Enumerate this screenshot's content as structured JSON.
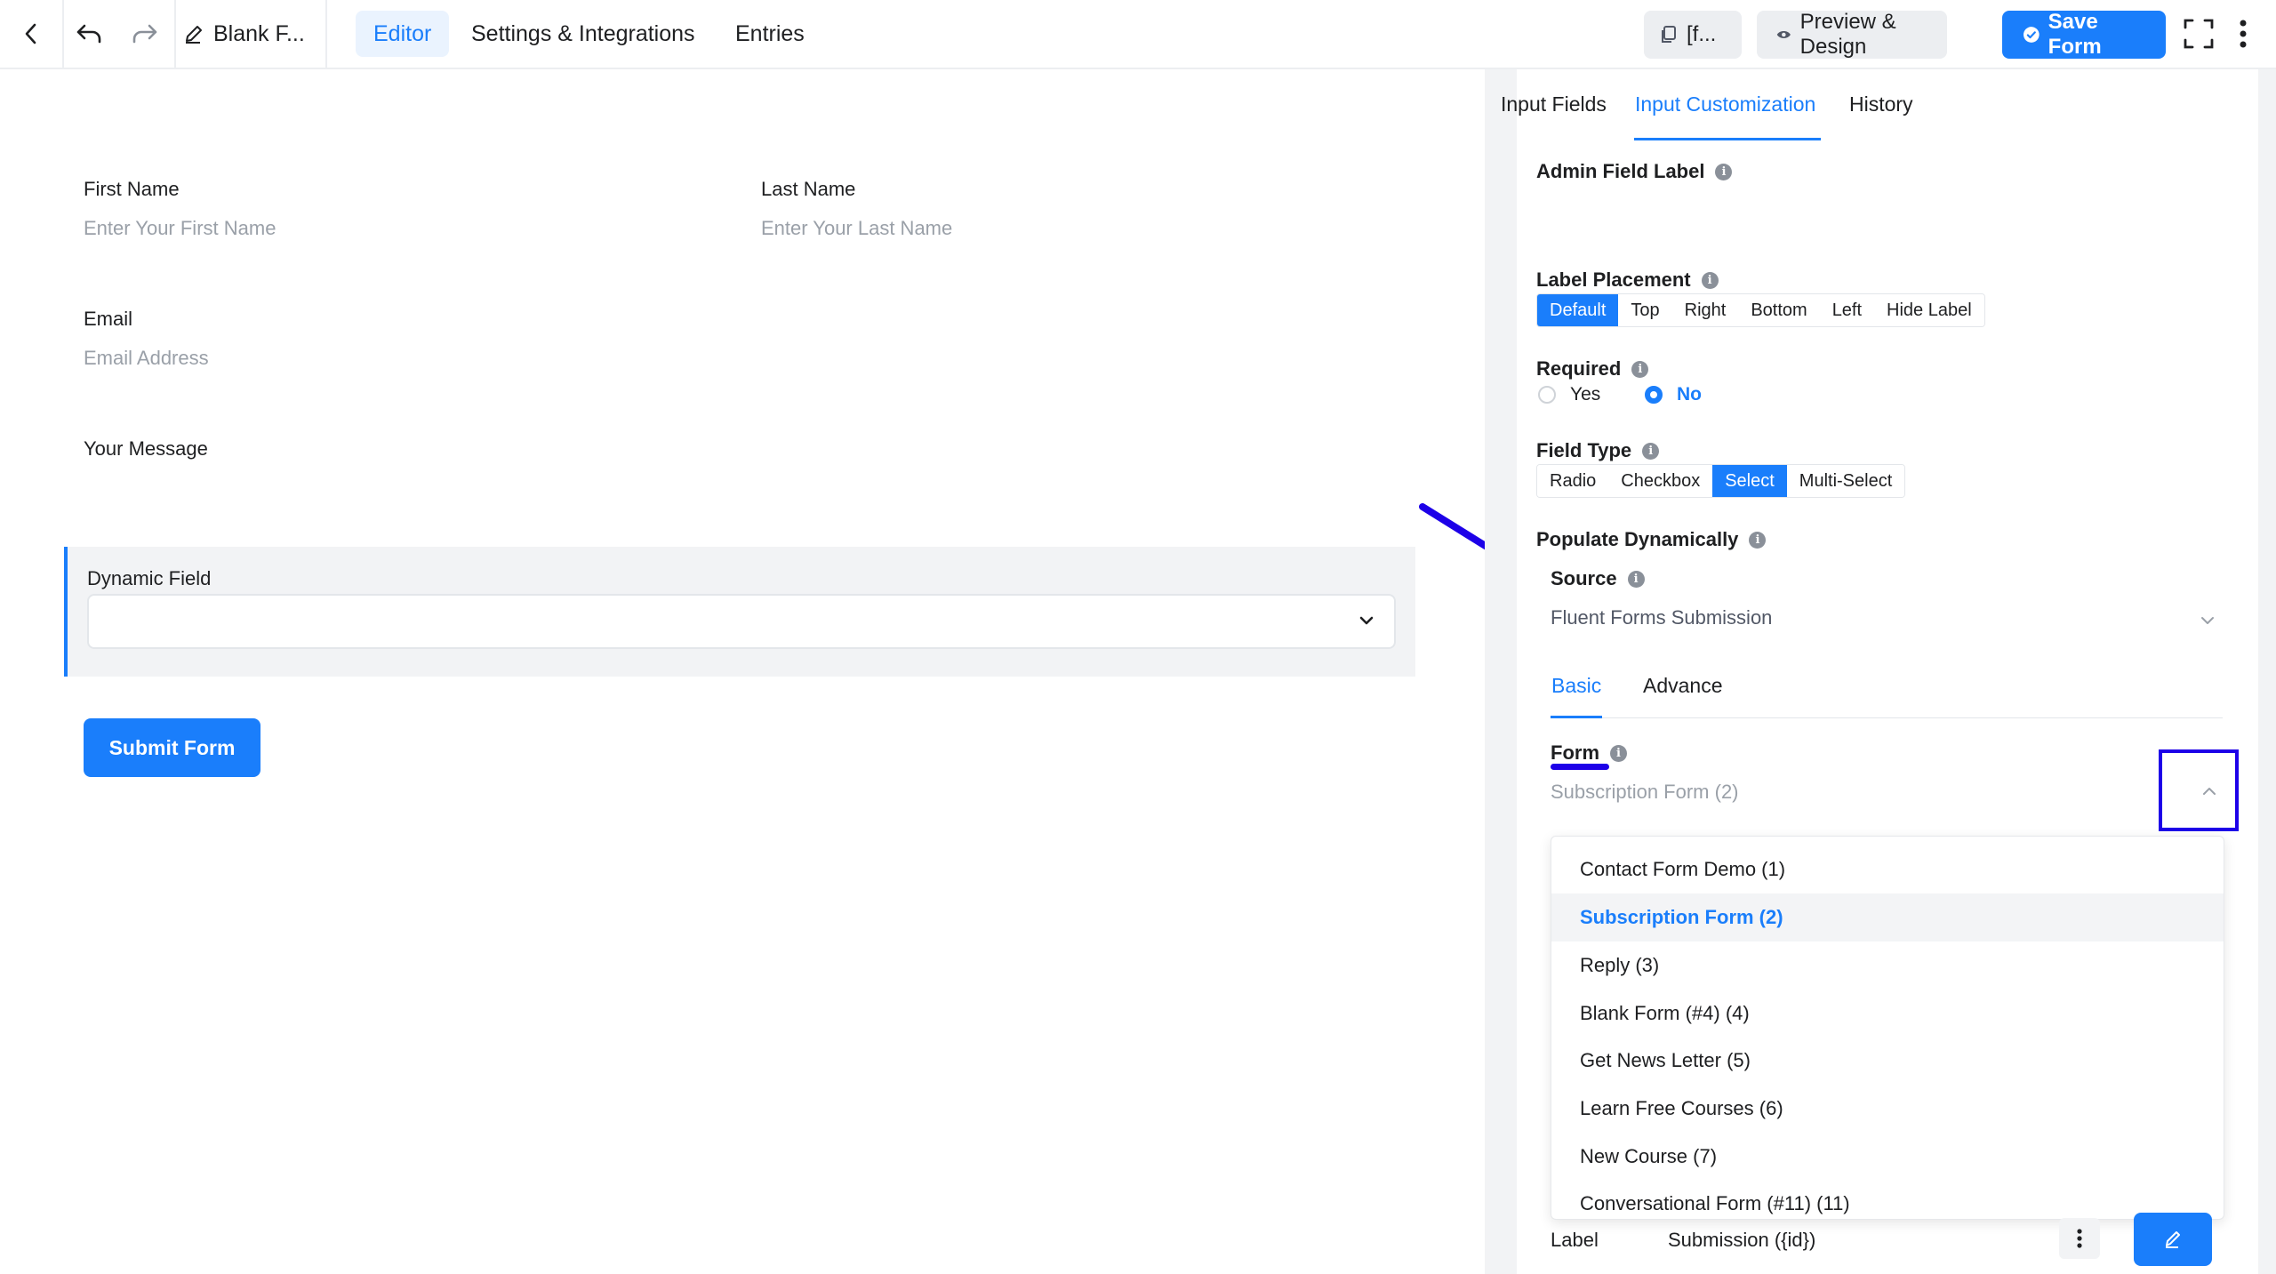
{
  "topbar": {
    "title": "Blank F...",
    "tabs": [
      "Editor",
      "Settings & Integrations",
      "Entries"
    ],
    "shortcode_label": "[f...",
    "preview_label": "Preview & Design",
    "save_label": "Save Form"
  },
  "form": {
    "first_name_label": "First Name",
    "first_name_placeholder": "Enter Your First Name",
    "last_name_label": "Last Name",
    "last_name_placeholder": "Enter Your Last Name",
    "email_label": "Email",
    "email_placeholder": "Email Address",
    "message_label": "Your Message",
    "dynamic_label": "Dynamic Field",
    "submit_label": "Submit Form"
  },
  "panel": {
    "tabs": [
      "Input Fields",
      "Input Customization",
      "History"
    ],
    "admin_label": "Admin Field Label",
    "label_placement": {
      "title": "Label Placement",
      "options": [
        "Default",
        "Top",
        "Right",
        "Bottom",
        "Left",
        "Hide Label"
      ]
    },
    "required": {
      "title": "Required",
      "yes": "Yes",
      "no": "No"
    },
    "field_type": {
      "title": "Field Type",
      "options": [
        "Radio",
        "Checkbox",
        "Select",
        "Multi-Select"
      ]
    },
    "populate_title": "Populate Dynamically",
    "source_title": "Source",
    "source_value": "Fluent Forms Submission",
    "subtabs": [
      "Basic",
      "Advance"
    ],
    "form_title": "Form",
    "form_value": "Subscription Form (2)",
    "form_options": [
      "Contact Form Demo (1)",
      "Subscription Form (2)",
      "Reply (3)",
      "Blank Form (#4) (4)",
      "Get News Letter (5)",
      "Learn Free Courses (6)",
      "New Course (7)",
      "Conversational Form (#11) (11)"
    ],
    "label_row_title": "Label",
    "label_row_value": "Submission ({id})"
  },
  "colors": {
    "accent": "#1a7efb",
    "annotation": "#1d00e8"
  }
}
